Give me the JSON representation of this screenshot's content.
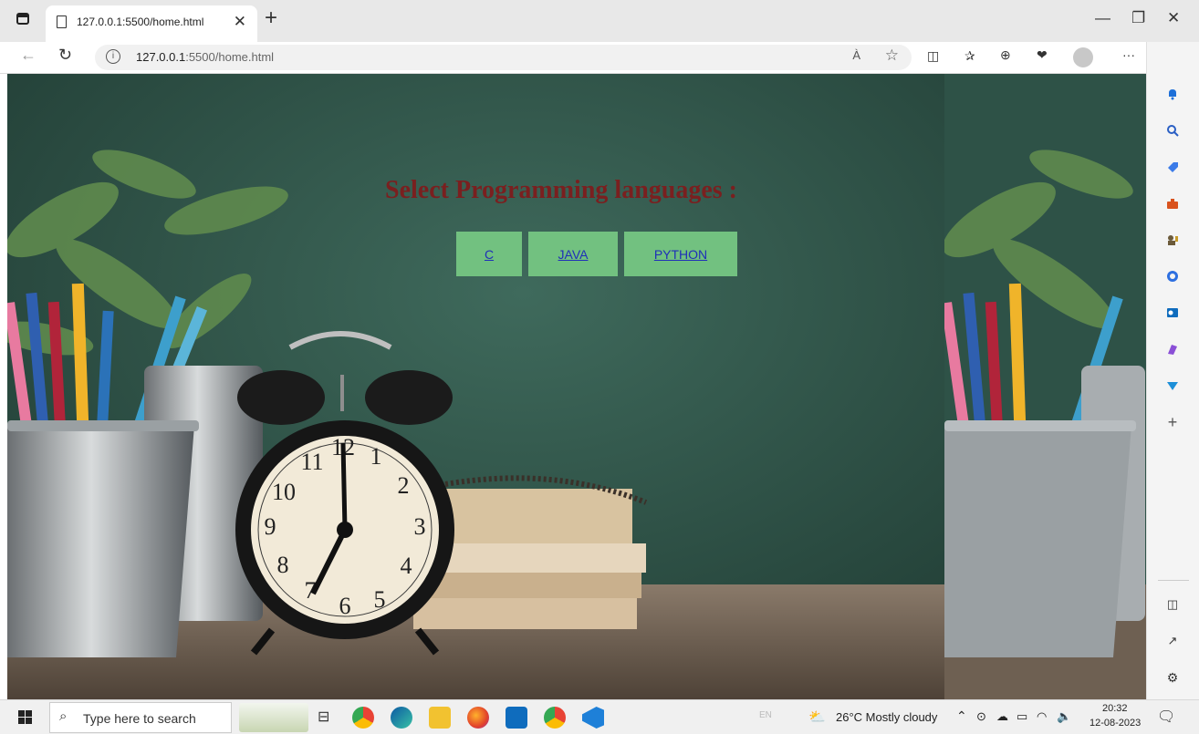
{
  "browser": {
    "tab_title": "127.0.0.1:5500/home.html",
    "url_host": "127.0.0.1",
    "url_rest": ":5500/home.html",
    "read_aloud": "À"
  },
  "page": {
    "heading": "Select Programming languages :",
    "buttons": [
      {
        "label": "C"
      },
      {
        "label": "JAVA"
      },
      {
        "label": "PYTHON"
      }
    ],
    "heading_color": "#7a1f1f",
    "button_color": "#72c180",
    "link_color": "#1f2fb8"
  },
  "taskbar": {
    "search_placeholder": "Type here to search",
    "weather": "26°C  Mostly cloudy",
    "time": "20:32",
    "date": "12-08-2023",
    "lang": "EN"
  }
}
